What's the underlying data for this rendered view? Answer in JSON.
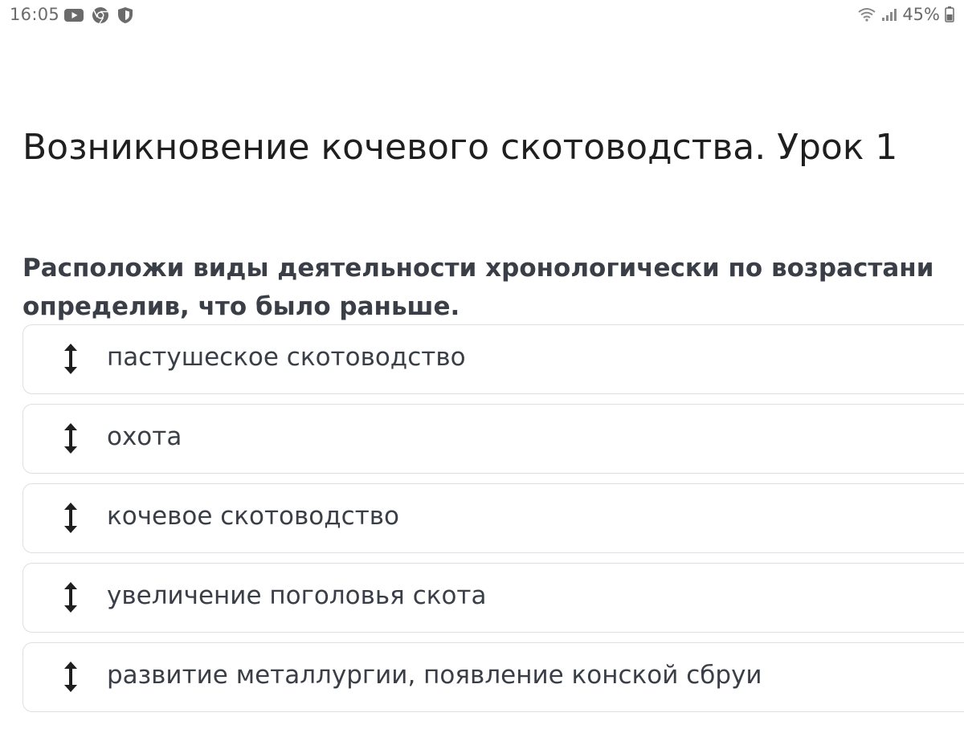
{
  "status_bar": {
    "time": "16:05",
    "battery": "45%",
    "icons_left": [
      "youtube-icon",
      "chrome-icon",
      "shield-icon"
    ],
    "icons_right": [
      "wifi-icon",
      "signal-icon",
      "battery-icon"
    ]
  },
  "title": "Возникновение кочевого скотоводства. Урок 1",
  "question": {
    "line1": "Расположи виды деятельности хронологически по возрастани",
    "line2": "определив, что было раньше."
  },
  "items": [
    {
      "label": "пастушеское скотоводство"
    },
    {
      "label": "охота"
    },
    {
      "label": "кочевое скотоводство"
    },
    {
      "label": "увеличение поголовья скота"
    },
    {
      "label": "развитие металлургии, появление конской сбруи"
    }
  ],
  "colors": {
    "text_primary": "#1f1f1f",
    "text_secondary": "#3a3f47",
    "status_gray": "#6b6b6b",
    "card_border": "#dcdfe3"
  }
}
